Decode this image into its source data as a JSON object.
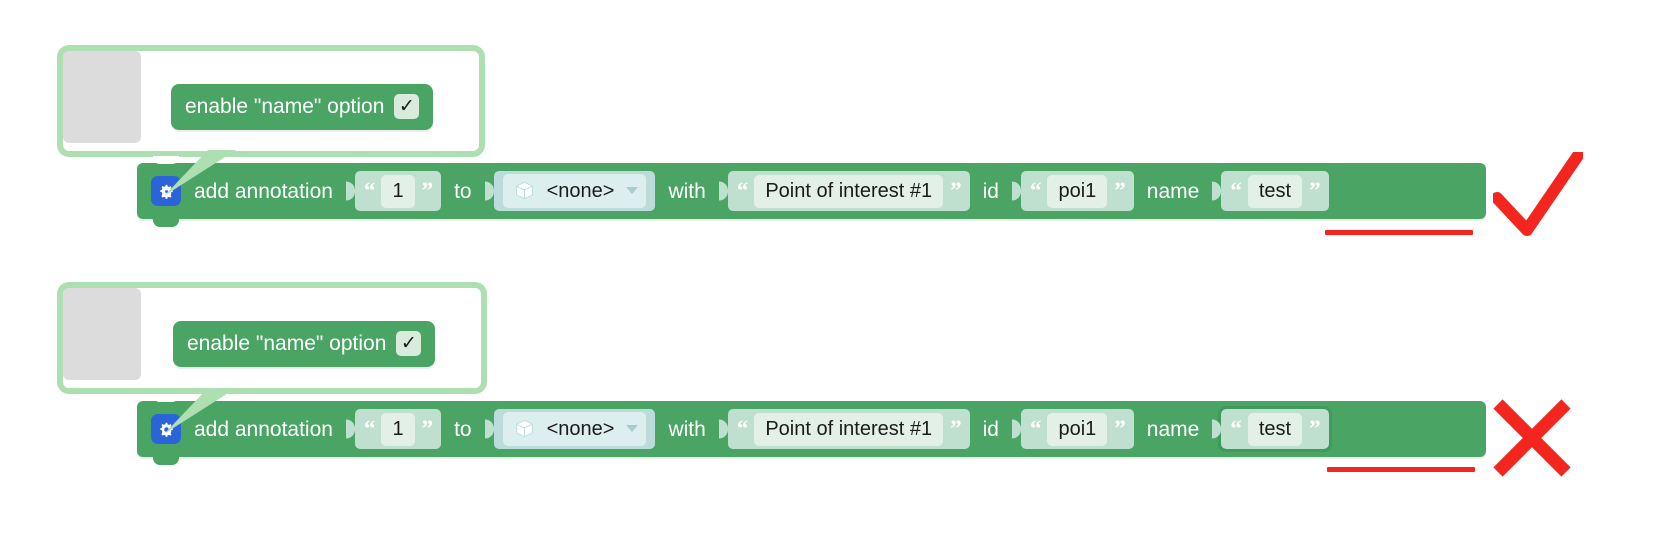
{
  "editor": {
    "name": "block-editor-canvas",
    "background": "#ffffff",
    "grid_color": "#dcdcdc",
    "grid_spacing_px": 32
  },
  "colors": {
    "block_green": "#4aa564",
    "comment_border_green": "#aedfb0",
    "input_shadow_green": "#bfe0cf",
    "input_field_green": "#e2f0e8",
    "dropdown_shadow": "#bcdcdc",
    "dropdown_field": "#ddeeee",
    "gear_blue": "#2b63d9",
    "mark_red": "#f2261e",
    "selected_outline": "#3f9a5c",
    "resize_gray": "#dcdcdc"
  },
  "rows": [
    {
      "id": "row-correct",
      "status": "correct",
      "status_mark": "check-mark",
      "comment": {
        "name": "comment-bubble",
        "resize_handle": "comment-resize-handle",
        "block": {
          "label": "enable \"name\" option",
          "checkbox_glyph": "✓",
          "checkbox_name": "enable-name-option-checkbox"
        }
      },
      "statement": {
        "icon": "gear-icon",
        "label": "add annotation",
        "inputs": [
          {
            "kind": "text",
            "name": "annotation-number-input",
            "value": "1"
          },
          {
            "kind": "label",
            "name": "to-label",
            "value": "to"
          },
          {
            "kind": "dropdown",
            "name": "target-object-dropdown",
            "value": "<none>",
            "icon": "cube-icon"
          },
          {
            "kind": "label",
            "name": "with-label",
            "value": "with"
          },
          {
            "kind": "text",
            "name": "annotation-description-input",
            "value": "Point of interest #1"
          },
          {
            "kind": "label",
            "name": "id-label",
            "value": "id"
          },
          {
            "kind": "text",
            "name": "annotation-id-input",
            "value": "poi1"
          },
          {
            "kind": "label",
            "name": "name-label",
            "value": "name"
          },
          {
            "kind": "text",
            "name": "annotation-name-input",
            "value": "test",
            "selected": false
          }
        ]
      }
    },
    {
      "id": "row-incorrect",
      "status": "incorrect",
      "status_mark": "cross-mark",
      "comment": {
        "name": "comment-bubble",
        "resize_handle": "comment-resize-handle",
        "block": {
          "label": "enable \"name\" option",
          "checkbox_glyph": "✓",
          "checkbox_name": "enable-name-option-checkbox"
        }
      },
      "statement": {
        "icon": "gear-icon",
        "label": "add annotation",
        "inputs": [
          {
            "kind": "text",
            "name": "annotation-number-input",
            "value": "1"
          },
          {
            "kind": "label",
            "name": "to-label",
            "value": "to"
          },
          {
            "kind": "dropdown",
            "name": "target-object-dropdown",
            "value": "<none>",
            "icon": "cube-icon"
          },
          {
            "kind": "label",
            "name": "with-label",
            "value": "with"
          },
          {
            "kind": "text",
            "name": "annotation-description-input",
            "value": "Point of interest #1"
          },
          {
            "kind": "label",
            "name": "id-label",
            "value": "id"
          },
          {
            "kind": "text",
            "name": "annotation-id-input",
            "value": "poi1"
          },
          {
            "kind": "label",
            "name": "name-label",
            "value": "name"
          },
          {
            "kind": "text",
            "name": "annotation-name-input",
            "value": "test",
            "selected": true
          }
        ]
      }
    }
  ]
}
